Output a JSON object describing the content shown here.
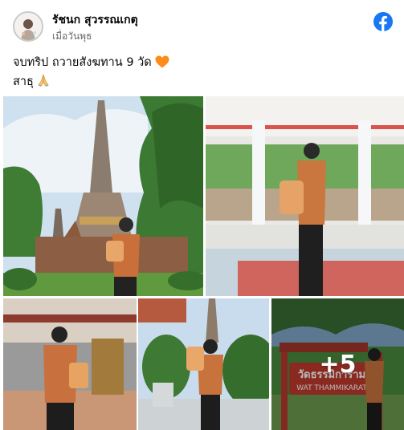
{
  "post": {
    "author_name": "รัชนก สุวรรณเกตุ",
    "timestamp": "เมื่อวันพุธ",
    "caption_line1": "จบทริป ถวายสังฆทาน 9 วัด",
    "caption_line2": "สาธุ",
    "more_photos_label": "+5",
    "sign_text": "วัดธรรมิการาม",
    "sign_subtext": "WAT THAMMIKARAT"
  },
  "icons": {
    "brand": "facebook-icon",
    "heart": "orange-heart-icon",
    "pray": "folded-hands-icon"
  },
  "colors": {
    "facebook_blue": "#1877f2",
    "heart_orange": "#ff8c1a",
    "text_primary": "#050505",
    "text_secondary": "#65676b"
  }
}
